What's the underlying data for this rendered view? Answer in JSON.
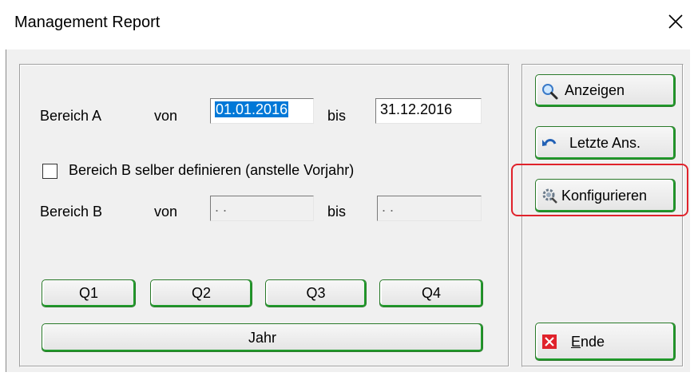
{
  "window": {
    "title": "Management Report"
  },
  "bereich_a": {
    "label": "Bereich A",
    "von_label": "von",
    "von_value": "01.01.2016",
    "bis_label": "bis",
    "bis_value": "31.12.2016"
  },
  "checkbox": {
    "label": "Bereich B selber definieren (anstelle Vorjahr)",
    "checked": false
  },
  "bereich_b": {
    "label": "Bereich B",
    "von_label": "von",
    "von_value": ". .",
    "bis_label": "bis",
    "bis_value": ". ."
  },
  "quarters": [
    "Q1",
    "Q2",
    "Q3",
    "Q4"
  ],
  "year_button": "Jahr",
  "side_buttons": {
    "anzeigen": "Anzeigen",
    "letzte": "Letzte Ans.",
    "konfigurieren": "Konfigurieren",
    "ende_first": "E",
    "ende_rest": "nde"
  },
  "colors": {
    "accent_green": "#1f9a2a",
    "selection_blue": "#0078d7",
    "highlight_red": "#e0222b"
  }
}
